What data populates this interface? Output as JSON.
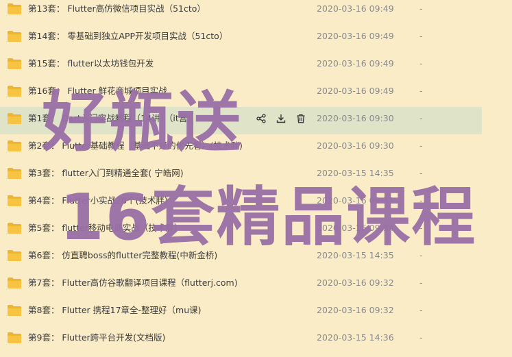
{
  "files": [
    {
      "name": "第13套：   Flutter高仿微信项目实战（51cto）",
      "date": "2020-03-16 09:49",
      "size": "-"
    },
    {
      "name": "第14套：   零基础到独立APP开发项目实战（51cto）",
      "date": "2020-03-16 09:49",
      "size": "-"
    },
    {
      "name": "第15套：   flutter以太坊钱包开发",
      "date": "2020-03-16 09:49",
      "size": "-"
    },
    {
      "name": "第16套：   Flutter 鲜花商城项目实战",
      "date": "2020-03-16 09:49",
      "size": "-"
    },
    {
      "name": "第1套：   Dart入门实战教程（14讲）（it营）",
      "date": "2020-03-16 09:30",
      "size": "-",
      "highlighted": true
    },
    {
      "name": "第2套：   Flutter基础教程（基础不好的优先看）(技术胖)",
      "date": "2020-03-16 09:30",
      "size": "-"
    },
    {
      "name": "第3套：   flutter入门到精通全套( 宁皓网)",
      "date": "2020-03-15 14:35",
      "size": "-"
    },
    {
      "name": "第4套：   Flutter小实战20个(技术胖)",
      "date": "2020-03-16 09:31",
      "size": "-"
    },
    {
      "name": "第5套：   flutter移动电商实战（技术胖）",
      "date": "2020-03-16 09:34",
      "size": "-"
    },
    {
      "name": "第6套：   仿直聘boss的flutter完整教程(中新金桥)",
      "date": "2020-03-15 14:35",
      "size": "-"
    },
    {
      "name": "第7套：   Flutter高仿谷歌翻译项目课程（flutterj.com)",
      "date": "2020-03-16 09:32",
      "size": "-"
    },
    {
      "name": "第8套：   Flutter 携程17章全-整理好（mu课)",
      "date": "2020-03-16 09:32",
      "size": "-"
    },
    {
      "name": "第9套：   Flutter跨平台开发(文档版)",
      "date": "2020-03-15 14:36",
      "size": "-"
    }
  ],
  "row_actions": [
    "share-icon",
    "download-icon",
    "delete-icon"
  ],
  "overlay": {
    "line1": "好瓶送",
    "line2": "16套精品课程"
  },
  "colors": {
    "background": "#fbecc8",
    "row_highlight": "#dfe4c9",
    "folder": "#f7c342",
    "overlay_text": "#9a6fa6",
    "date_text": "#8a8a8a"
  }
}
